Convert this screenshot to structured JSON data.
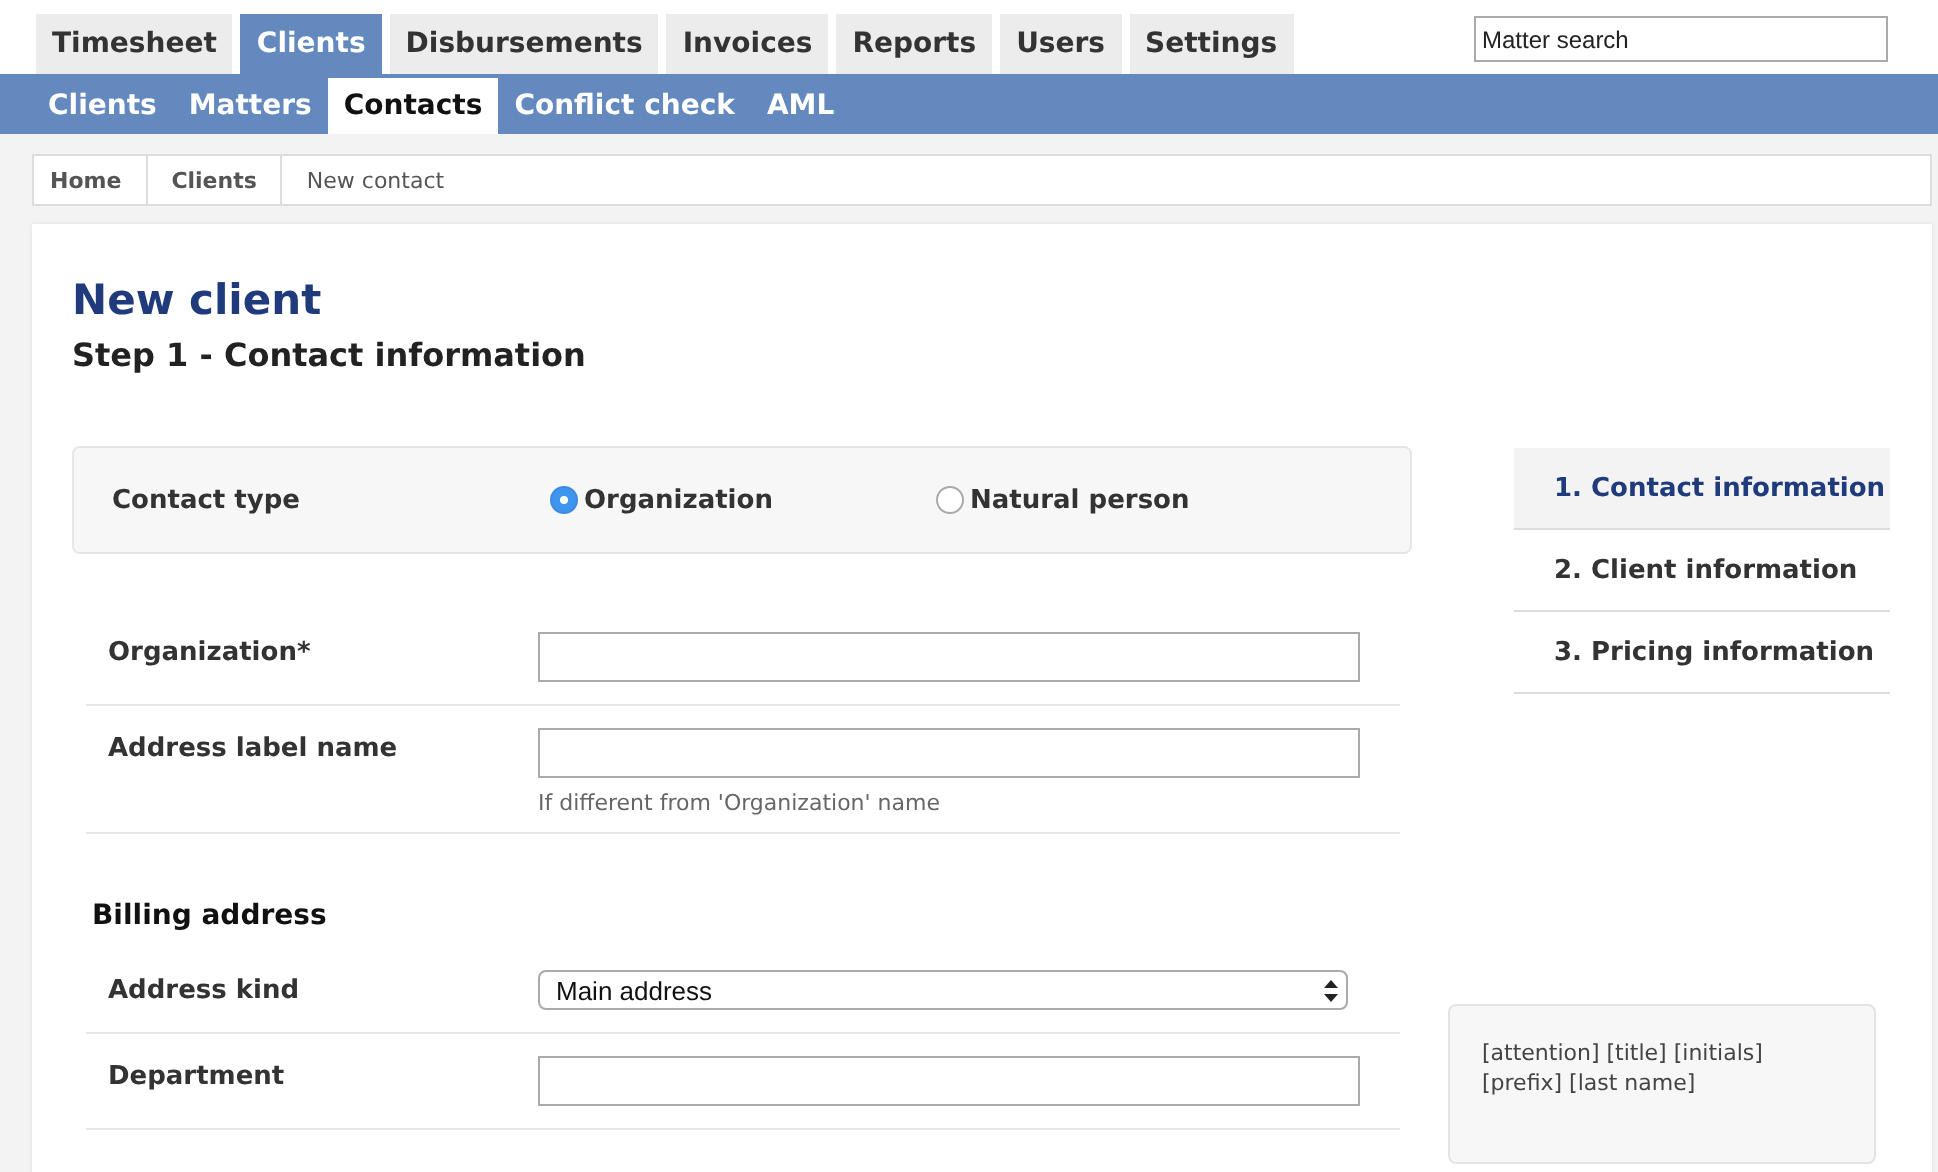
{
  "top_tabs": [
    {
      "label": "Timesheet",
      "selected": false
    },
    {
      "label": "Clients",
      "selected": true
    },
    {
      "label": "Disbursements",
      "selected": false
    },
    {
      "label": "Invoices",
      "selected": false
    },
    {
      "label": "Reports",
      "selected": false
    },
    {
      "label": "Users",
      "selected": false
    },
    {
      "label": "Settings",
      "selected": false
    }
  ],
  "search": {
    "placeholder": "Matter search"
  },
  "sub_tabs": [
    {
      "label": "Clients",
      "selected": false
    },
    {
      "label": "Matters",
      "selected": false
    },
    {
      "label": "Contacts",
      "selected": true
    },
    {
      "label": "Conflict check",
      "selected": false
    },
    {
      "label": "AML",
      "selected": false
    }
  ],
  "breadcrumb": [
    {
      "label": "Home",
      "current": false
    },
    {
      "label": "Clients",
      "current": false
    },
    {
      "label": "New contact",
      "current": true
    }
  ],
  "title": "New client",
  "subtitle": "Step 1 - Contact information",
  "contact_type": {
    "label": "Contact type",
    "options": [
      {
        "label": "Organization",
        "selected": true
      },
      {
        "label": "Natural person",
        "selected": false
      }
    ]
  },
  "fields": [
    {
      "label": "Organization*",
      "kind": "text"
    },
    {
      "label": "Address label name",
      "kind": "text",
      "hint": "If different from 'Organization' name"
    }
  ],
  "billing_address": {
    "heading": "Billing address",
    "fields": [
      {
        "label": "Address kind",
        "kind": "select",
        "value": "Main address"
      },
      {
        "label": "Department",
        "kind": "text"
      }
    ]
  },
  "steps": [
    {
      "label": "1. Contact information",
      "selected": true
    },
    {
      "label": "2. Client information",
      "selected": false
    },
    {
      "label": "3. Pricing information",
      "selected": false
    }
  ],
  "address_preview": {
    "lines": [
      "[attention] [title] [initials]",
      "[prefix] [last name]"
    ]
  }
}
